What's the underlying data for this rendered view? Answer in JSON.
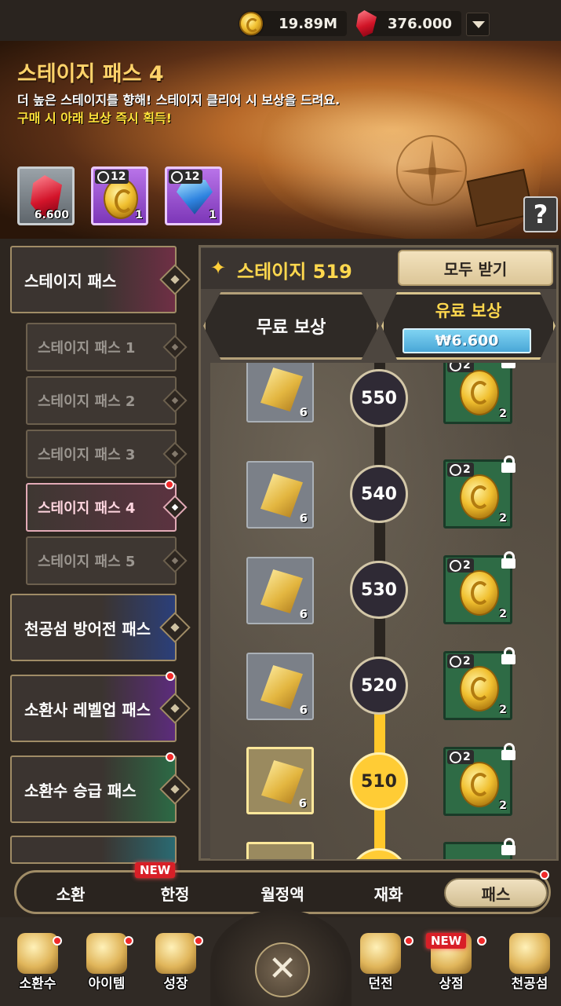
{
  "currency": {
    "gold": "19.89M",
    "ruby": "376.000"
  },
  "banner": {
    "title": "스테이지 패스 4",
    "description": "더 높은 스테이지를 향해! 스테이지 클리어 시 보상을 드려요.",
    "note": "구매 시 아래 보상 즉시 획득!",
    "rewards": [
      {
        "icon": "ruby-icon",
        "count": "6.600"
      },
      {
        "icon": "gold-coin-icon",
        "timer": "12",
        "count": "1"
      },
      {
        "icon": "blue-gem-icon",
        "timer": "12",
        "count": "1"
      }
    ],
    "help": "?"
  },
  "sidebar": {
    "items": [
      {
        "label": "스테이지 패스"
      },
      {
        "label": "스테이지 패스 1"
      },
      {
        "label": "스테이지 패스 2"
      },
      {
        "label": "스테이지 패스 3"
      },
      {
        "label": "스테이지 패스 4",
        "active": true
      },
      {
        "label": "스테이지 패스 5"
      },
      {
        "label": "천공섬 방어전 패스"
      },
      {
        "label": "소환사 레벨업 패스"
      },
      {
        "label": "소환수 승급 패스"
      }
    ]
  },
  "panel": {
    "stage_label": "스테이지 519",
    "claim_all": "모두 받기",
    "free_header": "무료 보상",
    "paid_header": "유료 보상",
    "price": "₩6.600",
    "rows": [
      {
        "level": "550",
        "free_count": "6",
        "paid_timer": "2",
        "paid_count": "2"
      },
      {
        "level": "540",
        "free_count": "6",
        "paid_timer": "2",
        "paid_count": "2"
      },
      {
        "level": "530",
        "free_count": "6",
        "paid_timer": "2",
        "paid_count": "2"
      },
      {
        "level": "520",
        "free_count": "6",
        "paid_timer": "2",
        "paid_count": "2"
      },
      {
        "level": "510",
        "free_count": "6",
        "paid_timer": "2",
        "paid_count": "2",
        "reached": true
      }
    ]
  },
  "tabs": {
    "items": [
      "소환",
      "한정",
      "월정액",
      "재화",
      "패스"
    ],
    "active": "패스",
    "new_badge": "NEW"
  },
  "nav": {
    "items": [
      {
        "label": "소환수",
        "icon": "summon-book-icon"
      },
      {
        "label": "아이템",
        "icon": "treasure-chest-icon"
      },
      {
        "label": "성장",
        "icon": "growth-arrow-icon"
      },
      {
        "label": "",
        "icon": "crossed-swords-icon"
      },
      {
        "label": "던전",
        "icon": "dungeon-swords-icon"
      },
      {
        "label": "상점",
        "icon": "shop-stall-icon"
      },
      {
        "label": "천공섬",
        "icon": "sky-island-icon"
      }
    ],
    "new_badge": "NEW",
    "center_glyph": "✕"
  }
}
